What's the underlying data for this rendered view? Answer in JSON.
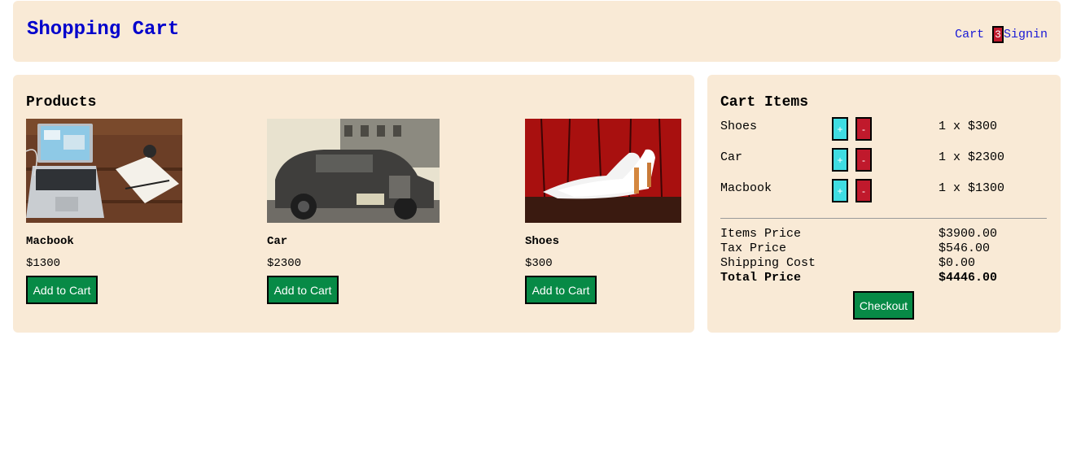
{
  "header": {
    "title": "Shopping Cart",
    "cart_label": "Cart",
    "cart_count": "3",
    "signin_label": "Signin"
  },
  "products": {
    "title": "Products",
    "items": [
      {
        "name": "Macbook",
        "price": "$1300",
        "button": "Add to Cart",
        "image": "laptop-photo"
      },
      {
        "name": "Car",
        "price": "$2300",
        "button": "Add to Cart",
        "image": "vintage-car-photo"
      },
      {
        "name": "Shoes",
        "price": "$300",
        "button": "Add to Cart",
        "image": "white-heels-photo"
      }
    ]
  },
  "cart": {
    "title": "Cart Items",
    "items": [
      {
        "name": "Shoes",
        "qty_text": "1 x $300",
        "plus": "+",
        "minus": "-"
      },
      {
        "name": "Car",
        "qty_text": "1 x $2300",
        "plus": "+",
        "minus": "-"
      },
      {
        "name": "Macbook",
        "qty_text": "1 x $1300",
        "plus": "+",
        "minus": "-"
      }
    ],
    "summary": {
      "items_price_label": "Items Price",
      "items_price": "$3900.00",
      "tax_price_label": "Tax Price",
      "tax_price": "$546.00",
      "shipping_label": "Shipping Cost",
      "shipping": "$0.00",
      "total_label": "Total Price",
      "total": "$4446.00"
    },
    "checkout_label": "Checkout"
  },
  "colors": {
    "panel": "#f9ead6",
    "brand": "#0000cc",
    "button_green": "#078a46",
    "plus": "#3fdde2",
    "minus": "#c0192c",
    "badge": "#c0192c"
  }
}
